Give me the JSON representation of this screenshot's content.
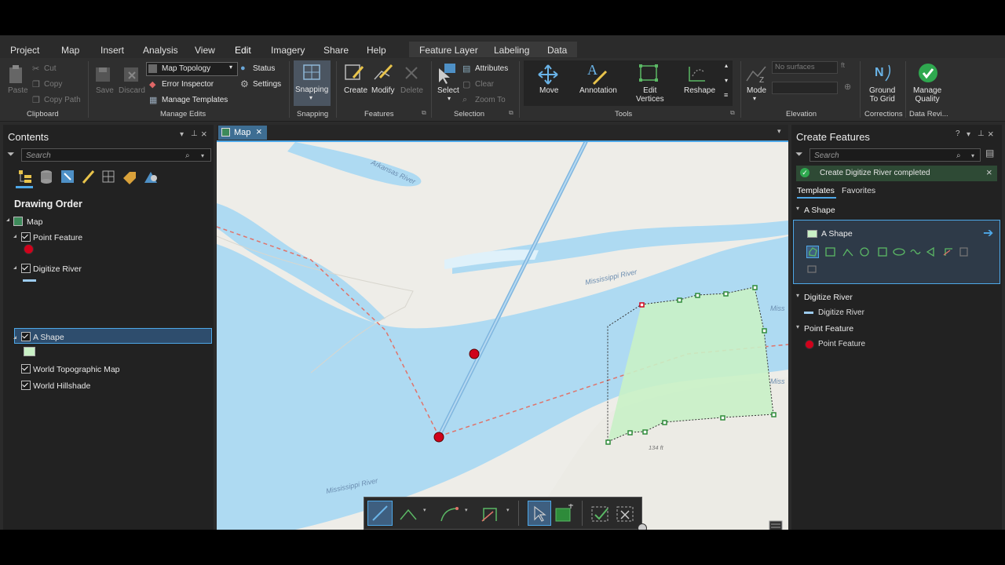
{
  "ribbon_tabs": [
    "Project",
    "Map",
    "Insert",
    "Analysis",
    "View",
    "Edit",
    "Imagery",
    "Share",
    "Help",
    "Feature Layer",
    "Labeling",
    "Data"
  ],
  "active_tab": "Edit",
  "clipboard": {
    "paste": "Paste",
    "cut": "Cut",
    "copy": "Copy",
    "copy_path": "Copy Path",
    "group": "Clipboard"
  },
  "manage_edits": {
    "save": "Save",
    "discard": "Discard",
    "topology_value": "Map Topology",
    "status": "Status",
    "error_inspector": "Error Inspector",
    "settings": "Settings",
    "manage_templates": "Manage Templates",
    "group": "Manage Edits"
  },
  "snapping": {
    "label": "Snapping",
    "group": "Snapping"
  },
  "features": {
    "create": "Create",
    "modify": "Modify",
    "delete": "Delete",
    "group": "Features"
  },
  "selection": {
    "select": "Select",
    "attributes": "Attributes",
    "clear": "Clear",
    "zoom_to": "Zoom To",
    "group": "Selection"
  },
  "tools": {
    "move": "Move",
    "annotation": "Annotation",
    "edit_vertices": "Edit\nVertices",
    "reshape": "Reshape",
    "group": "Tools"
  },
  "elevation": {
    "mode": "Mode",
    "surface_placeholder": "No surfaces",
    "group": "Elevation"
  },
  "corrections": {
    "ground_to_grid": "Ground\nTo Grid",
    "group": "Corrections"
  },
  "data_reviewer": {
    "manage_quality": "Manage\nQuality",
    "group": "Data Revi..."
  },
  "contents": {
    "title": "Contents",
    "search_placeholder": "Search",
    "heading": "Drawing Order",
    "map": "Map",
    "layers": [
      {
        "name": "Point Feature",
        "checked": true,
        "symbol": "red-dot"
      },
      {
        "name": "Digitize River",
        "checked": true,
        "symbol": "blue-line"
      },
      {
        "name": "A Shape",
        "checked": true,
        "symbol": "green-fill",
        "selected": true
      },
      {
        "name": "World Topographic Map",
        "checked": true
      },
      {
        "name": "World Hillshade",
        "checked": true
      }
    ]
  },
  "map_tab": {
    "label": "Map"
  },
  "map_labels": {
    "river_top": "Arkansas River",
    "river_mid": "Mississippi River",
    "river_bottom": "Mississippi River",
    "right_edge_1": "Miss",
    "right_edge_2": "Miss",
    "elevation": "134 ft"
  },
  "create_features": {
    "title": "Create Features",
    "search_placeholder": "Search",
    "banner": "Create Digitize River completed",
    "tab_templates": "Templates",
    "tab_favorites": "Favorites",
    "groups": [
      {
        "name": "A Shape",
        "item": "A Shape"
      },
      {
        "name": "Digitize River",
        "item": "Digitize River"
      },
      {
        "name": "Point Feature",
        "item": "Point Feature"
      }
    ]
  },
  "colors": {
    "accent": "#4ea8e8",
    "polygon_fill": "#c9f1c6",
    "point": "#d0021b",
    "river_line": "#7fb6df",
    "water": "#aedaf2",
    "land": "#eeede8"
  }
}
